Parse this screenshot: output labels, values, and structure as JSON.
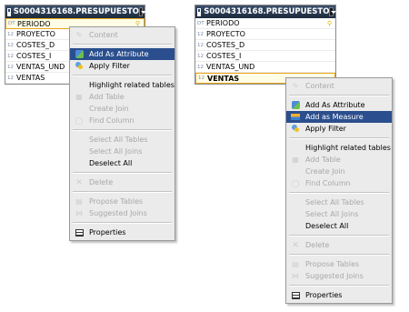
{
  "left": {
    "table": {
      "title": "S0004316168.PRESUPUESTO",
      "rows": [
        {
          "type": "DT",
          "label": "PERIODO",
          "key": true,
          "selected": true
        },
        {
          "type": "12",
          "label": "PROYECTO"
        },
        {
          "type": "12",
          "label": "COSTES_D"
        },
        {
          "type": "12",
          "label": "COSTES_I"
        },
        {
          "type": "12",
          "label": "VENTAS_UND"
        },
        {
          "type": "12",
          "label": "VENTAS"
        }
      ]
    },
    "menu": [
      {
        "label": "Content",
        "icon": "content-icon",
        "disabled": true
      },
      {
        "sep": true
      },
      {
        "label": "Add As Attribute",
        "icon": "attribute-icon",
        "highlight": true
      },
      {
        "label": "Apply Filter",
        "icon": "filter-icon"
      },
      {
        "sep": true
      },
      {
        "label": "Highlight related tables"
      },
      {
        "label": "Add Table",
        "icon": "add-table-icon",
        "disabled": true
      },
      {
        "label": "Create Join",
        "disabled": true
      },
      {
        "label": "Find Column",
        "icon": "find-column-icon",
        "disabled": true
      },
      {
        "sep": true
      },
      {
        "label": "Select All Tables",
        "disabled": true
      },
      {
        "label": "Select All Joins",
        "disabled": true
      },
      {
        "label": "Deselect All"
      },
      {
        "sep": true
      },
      {
        "label": "Delete",
        "icon": "delete-icon",
        "disabled": true
      },
      {
        "sep": true
      },
      {
        "label": "Propose Tables",
        "icon": "propose-tables-icon",
        "disabled": true
      },
      {
        "label": "Suggested Joins",
        "icon": "suggested-joins-icon",
        "disabled": true
      },
      {
        "sep": true
      },
      {
        "label": "Properties",
        "icon": "properties-icon"
      }
    ]
  },
  "right": {
    "table": {
      "title": "S0004316168.PRESUPUESTO",
      "rows": [
        {
          "type": "DT",
          "label": "PERIODO",
          "key": true
        },
        {
          "type": "12",
          "label": "PROYECTO"
        },
        {
          "type": "12",
          "label": "COSTES_D"
        },
        {
          "type": "12",
          "label": "COSTES_I"
        },
        {
          "type": "12",
          "label": "VENTAS_UND"
        },
        {
          "type": "12",
          "label": "VENTAS",
          "selected": true,
          "bold": true
        }
      ]
    },
    "menu": [
      {
        "label": "Content",
        "icon": "content-icon",
        "disabled": true
      },
      {
        "sep": true
      },
      {
        "label": "Add As Attribute",
        "icon": "attribute-icon"
      },
      {
        "label": "Add as Measure",
        "icon": "measure-icon",
        "highlight": true
      },
      {
        "label": "Apply Filter",
        "icon": "filter-icon"
      },
      {
        "sep": true
      },
      {
        "label": "Highlight related tables"
      },
      {
        "label": "Add Table",
        "icon": "add-table-icon",
        "disabled": true
      },
      {
        "label": "Create Join",
        "disabled": true
      },
      {
        "label": "Find Column",
        "icon": "find-column-icon",
        "disabled": true
      },
      {
        "sep": true
      },
      {
        "label": "Select All Tables",
        "disabled": true
      },
      {
        "label": "Select All Joins",
        "disabled": true
      },
      {
        "label": "Deselect All"
      },
      {
        "sep": true
      },
      {
        "label": "Delete",
        "icon": "delete-icon",
        "disabled": true
      },
      {
        "sep": true
      },
      {
        "label": "Propose Tables",
        "icon": "propose-tables-icon",
        "disabled": true
      },
      {
        "label": "Suggested Joins",
        "icon": "suggested-joins-icon",
        "disabled": true
      },
      {
        "sep": true
      },
      {
        "label": "Properties",
        "icon": "properties-icon"
      }
    ]
  },
  "colors": {
    "highlight": "#2b4f8e",
    "header": "#1d2a3d",
    "selection_border": "#e8a51b"
  }
}
